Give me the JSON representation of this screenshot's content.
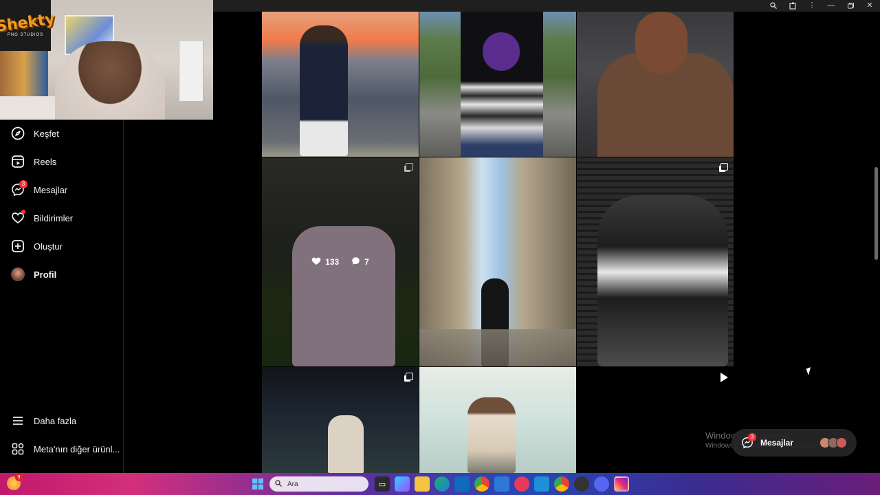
{
  "webcam": {
    "logo_text": "Shekty",
    "logo_subtitle": "PNG STUDIOS"
  },
  "sidebar": {
    "items": [
      {
        "label": "Keşfet",
        "icon": "compass-icon"
      },
      {
        "label": "Reels",
        "icon": "reels-icon"
      },
      {
        "label": "Mesajlar",
        "icon": "messenger-icon",
        "badge": "3"
      },
      {
        "label": "Bildirimler",
        "icon": "heart-icon",
        "dot": true
      },
      {
        "label": "Oluştur",
        "icon": "plus-square-icon"
      },
      {
        "label": "Profil",
        "icon": "avatar"
      }
    ],
    "more_label": "Daha fazla",
    "meta_label": "Meta'nın diğer ürünl..."
  },
  "grid": {
    "hovered_post": {
      "likes": "133",
      "comments": "7"
    }
  },
  "watermark": {
    "line1": "Windows'u Etkinleştir",
    "line2": "Windows'u etkinleştirmek için Ayarlar'a gidin."
  },
  "messages_pill": {
    "label": "Mesajlar",
    "badge": "3"
  },
  "taskbar": {
    "weather_badge": "9",
    "search_placeholder": "Ara"
  },
  "colors": {
    "notification_red": "#ff3040",
    "background": "#000000"
  }
}
